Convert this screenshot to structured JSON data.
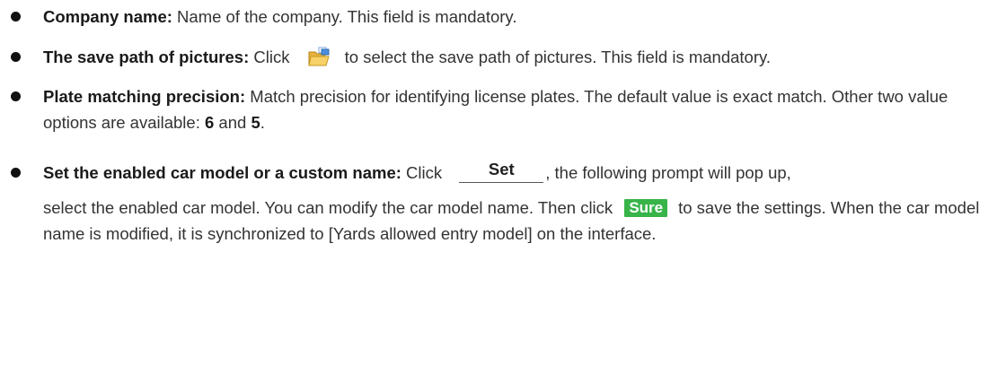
{
  "items": [
    {
      "term": "Company name:",
      "text": " Name of the company. This field is mandatory."
    },
    {
      "term": "The save path of pictures:",
      "text_before": " Click ",
      "icon": "folder-open-icon",
      "text_after": "to select the save path of pictures. This field is mandatory."
    },
    {
      "term": "Plate matching precision:",
      "text_a": " Match precision for identifying license plates. The default value is exact match. Other two value options are available: ",
      "value_1": "6",
      "text_and": " and ",
      "value_2": "5",
      "text_end": "."
    },
    {
      "term": "Set the enabled car model or a custom name:",
      "text_before": " Click ",
      "button_label": "Set",
      "text_line1": ", the following prompt will pop up,",
      "text_line2a": "select the enabled car model. You can modify the car model name. Then click ",
      "sure_label": "Sure",
      "text_line2b": "to save the settings. When the car model name is modified, it is synchronized to [Yards allowed entry model] on the interface."
    }
  ],
  "colors": {
    "sure_button_bg": "#38b449",
    "text": "#333333"
  }
}
